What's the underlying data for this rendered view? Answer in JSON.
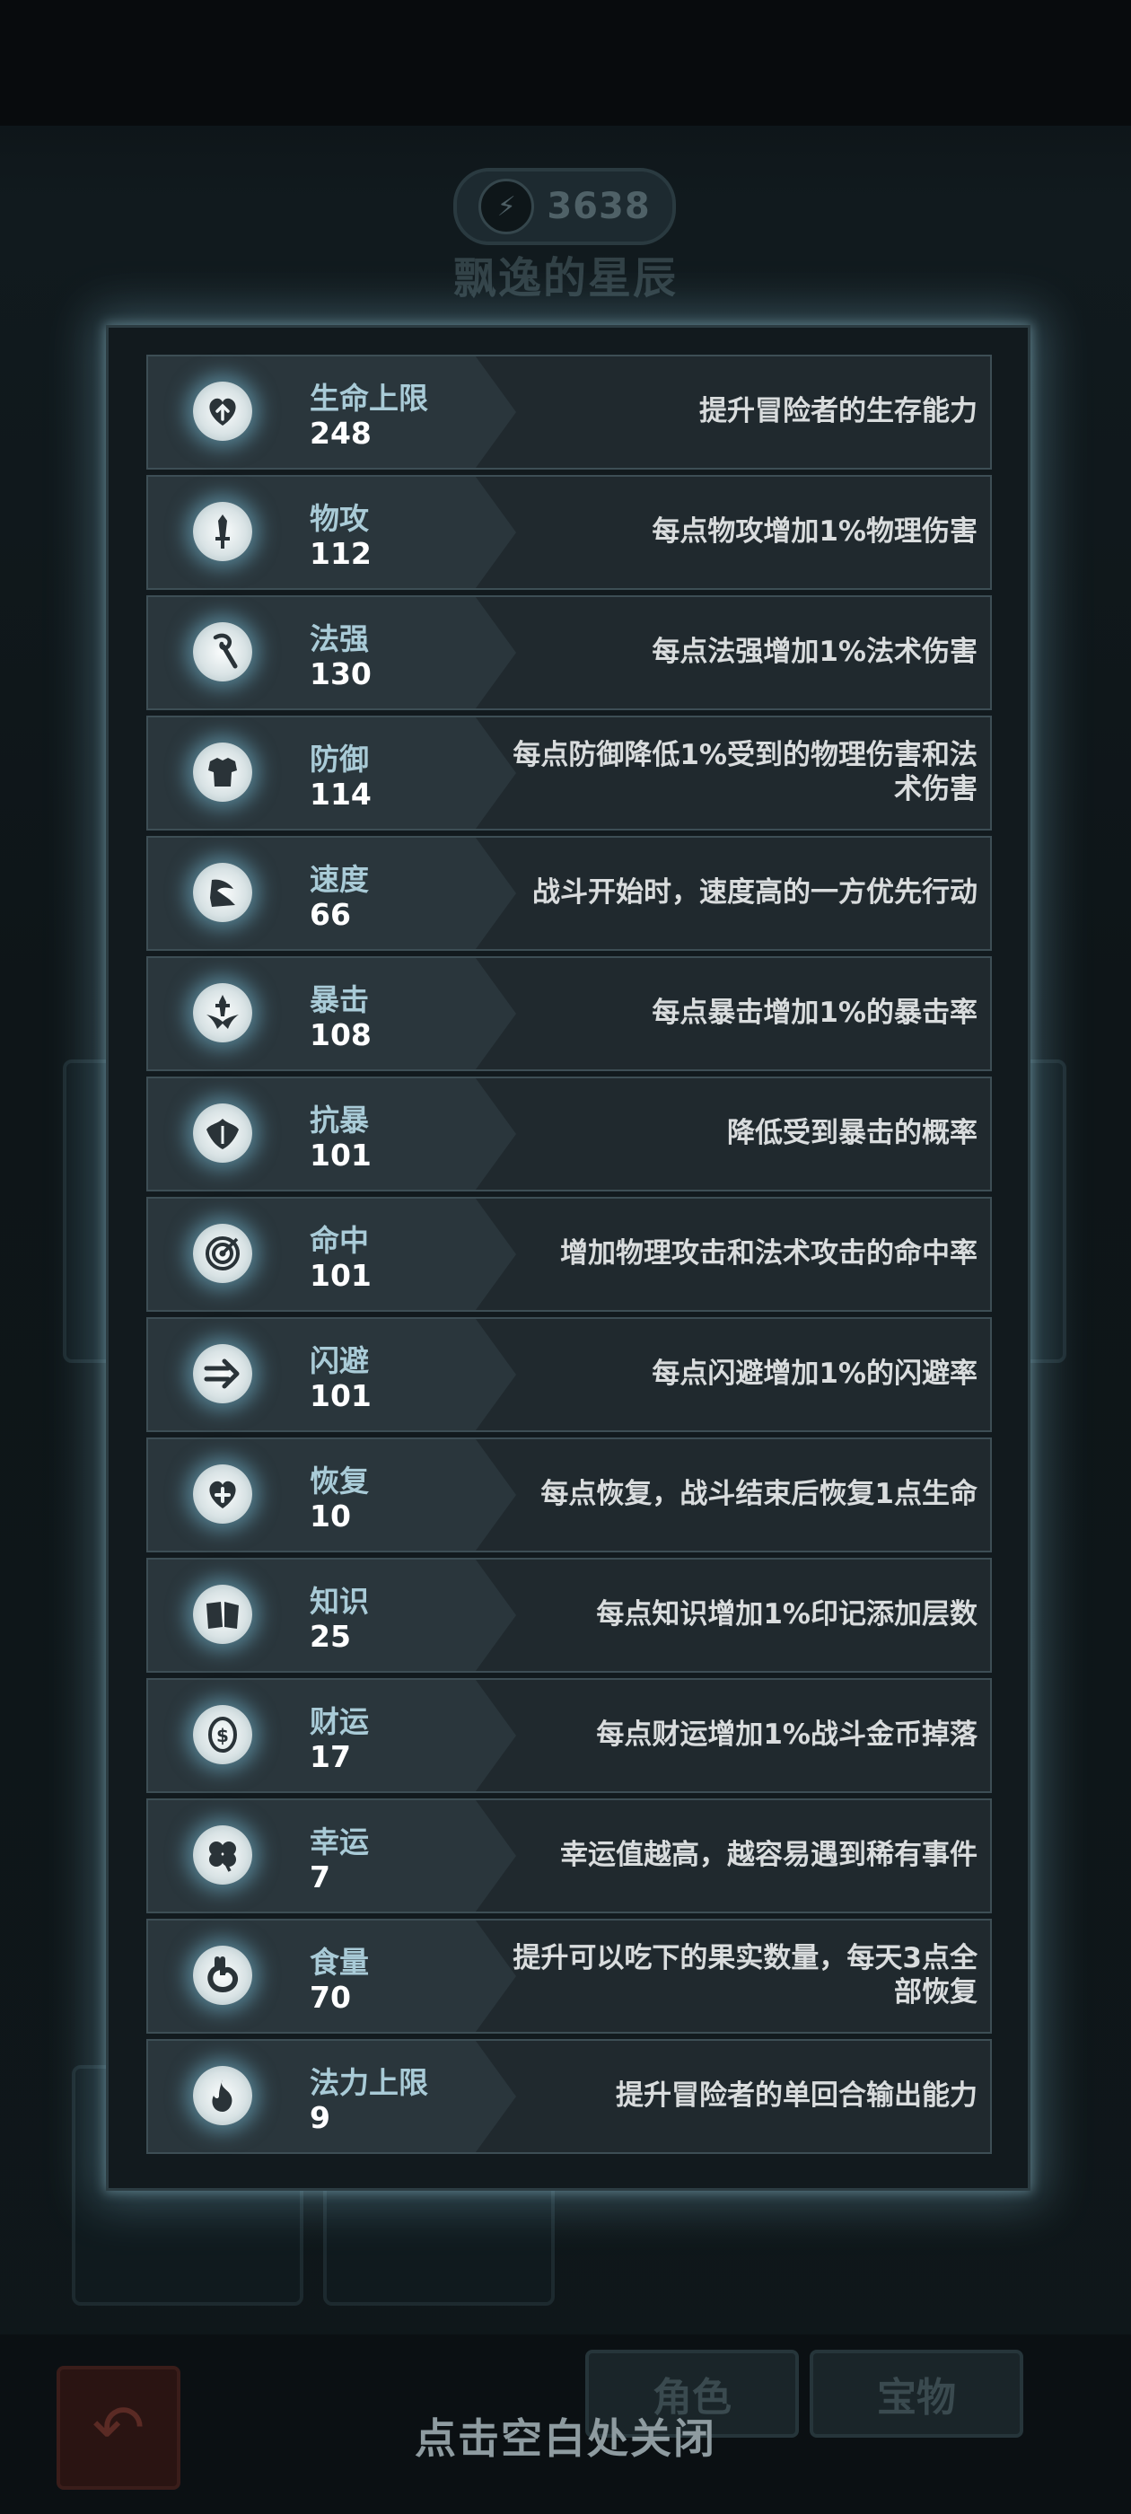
{
  "header": {
    "power_value": "3638",
    "hero_name": "飘逸的星辰"
  },
  "stats": [
    {
      "name": "生命上限",
      "value": "248",
      "desc": "提升冒险者的生存能力",
      "icon": "heart-up-icon"
    },
    {
      "name": "物攻",
      "value": "112",
      "desc": "每点物攻增加1%物理伤害",
      "icon": "sword-icon"
    },
    {
      "name": "法强",
      "value": "130",
      "desc": "每点法强增加1%法术伤害",
      "icon": "staff-icon"
    },
    {
      "name": "防御",
      "value": "114",
      "desc": "每点防御降低1%受到的物理伤害和法术伤害",
      "icon": "armor-icon"
    },
    {
      "name": "速度",
      "value": "66",
      "desc": "战斗开始时，速度高的一方优先行动",
      "icon": "winged-boot-icon"
    },
    {
      "name": "暴击",
      "value": "108",
      "desc": "每点暴击增加1%的暴击率",
      "icon": "crit-dagger-icon"
    },
    {
      "name": "抗暴",
      "value": "101",
      "desc": "降低受到暴击的概率",
      "icon": "shield-burst-icon"
    },
    {
      "name": "命中",
      "value": "101",
      "desc": "增加物理攻击和法术攻击的命中率",
      "icon": "target-icon"
    },
    {
      "name": "闪避",
      "value": "101",
      "desc": "每点闪避增加1%的闪避率",
      "icon": "dodge-arrow-icon"
    },
    {
      "name": "恢复",
      "value": "10",
      "desc": "每点恢复，战斗结束后恢复1点生命",
      "icon": "heart-plus-icon"
    },
    {
      "name": "知识",
      "value": "25",
      "desc": "每点知识增加1%印记添加层数",
      "icon": "book-icon"
    },
    {
      "name": "财运",
      "value": "17",
      "desc": "每点财运增加1%战斗金币掉落",
      "icon": "coin-icon"
    },
    {
      "name": "幸运",
      "value": "7",
      "desc": "幸运值越高，越容易遇到稀有事件",
      "icon": "clover-icon"
    },
    {
      "name": "食量",
      "value": "70",
      "desc": "提升可以吃下的果实数量，每天3点全部恢复",
      "icon": "stomach-icon"
    },
    {
      "name": "法力上限",
      "value": "9",
      "desc": "提升冒险者的单回合输出能力",
      "icon": "mana-flame-icon"
    }
  ],
  "bottom": {
    "close_hint": "点击空白处关闭",
    "tab_role": "角色",
    "tab_treasure": "宝物"
  }
}
